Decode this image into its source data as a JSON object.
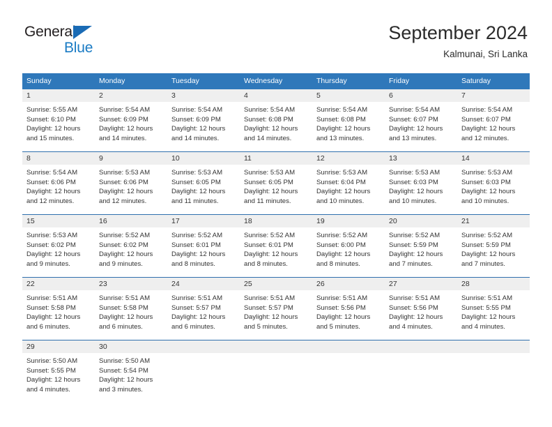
{
  "logo": {
    "line1": "General",
    "line2": "Blue",
    "triangle_icon": "blue-triangle-icon",
    "colors": {
      "general": "#231f20",
      "blue": "#1a7bc4",
      "triangle": "#1a6bb5"
    }
  },
  "header": {
    "title": "September 2024",
    "subtitle": "Kalmunai, Sri Lanka"
  },
  "colors": {
    "header_bar": "#2f78ba",
    "row_divider": "#2f6fad",
    "day_band": "#efefef",
    "text": "#333333"
  },
  "weekdays": [
    "Sunday",
    "Monday",
    "Tuesday",
    "Wednesday",
    "Thursday",
    "Friday",
    "Saturday"
  ],
  "weeks": [
    [
      {
        "day": "1",
        "sunrise": "Sunrise: 5:55 AM",
        "sunset": "Sunset: 6:10 PM",
        "daylight1": "Daylight: 12 hours",
        "daylight2": "and 15 minutes."
      },
      {
        "day": "2",
        "sunrise": "Sunrise: 5:54 AM",
        "sunset": "Sunset: 6:09 PM",
        "daylight1": "Daylight: 12 hours",
        "daylight2": "and 14 minutes."
      },
      {
        "day": "3",
        "sunrise": "Sunrise: 5:54 AM",
        "sunset": "Sunset: 6:09 PM",
        "daylight1": "Daylight: 12 hours",
        "daylight2": "and 14 minutes."
      },
      {
        "day": "4",
        "sunrise": "Sunrise: 5:54 AM",
        "sunset": "Sunset: 6:08 PM",
        "daylight1": "Daylight: 12 hours",
        "daylight2": "and 14 minutes."
      },
      {
        "day": "5",
        "sunrise": "Sunrise: 5:54 AM",
        "sunset": "Sunset: 6:08 PM",
        "daylight1": "Daylight: 12 hours",
        "daylight2": "and 13 minutes."
      },
      {
        "day": "6",
        "sunrise": "Sunrise: 5:54 AM",
        "sunset": "Sunset: 6:07 PM",
        "daylight1": "Daylight: 12 hours",
        "daylight2": "and 13 minutes."
      },
      {
        "day": "7",
        "sunrise": "Sunrise: 5:54 AM",
        "sunset": "Sunset: 6:07 PM",
        "daylight1": "Daylight: 12 hours",
        "daylight2": "and 12 minutes."
      }
    ],
    [
      {
        "day": "8",
        "sunrise": "Sunrise: 5:54 AM",
        "sunset": "Sunset: 6:06 PM",
        "daylight1": "Daylight: 12 hours",
        "daylight2": "and 12 minutes."
      },
      {
        "day": "9",
        "sunrise": "Sunrise: 5:53 AM",
        "sunset": "Sunset: 6:06 PM",
        "daylight1": "Daylight: 12 hours",
        "daylight2": "and 12 minutes."
      },
      {
        "day": "10",
        "sunrise": "Sunrise: 5:53 AM",
        "sunset": "Sunset: 6:05 PM",
        "daylight1": "Daylight: 12 hours",
        "daylight2": "and 11 minutes."
      },
      {
        "day": "11",
        "sunrise": "Sunrise: 5:53 AM",
        "sunset": "Sunset: 6:05 PM",
        "daylight1": "Daylight: 12 hours",
        "daylight2": "and 11 minutes."
      },
      {
        "day": "12",
        "sunrise": "Sunrise: 5:53 AM",
        "sunset": "Sunset: 6:04 PM",
        "daylight1": "Daylight: 12 hours",
        "daylight2": "and 10 minutes."
      },
      {
        "day": "13",
        "sunrise": "Sunrise: 5:53 AM",
        "sunset": "Sunset: 6:03 PM",
        "daylight1": "Daylight: 12 hours",
        "daylight2": "and 10 minutes."
      },
      {
        "day": "14",
        "sunrise": "Sunrise: 5:53 AM",
        "sunset": "Sunset: 6:03 PM",
        "daylight1": "Daylight: 12 hours",
        "daylight2": "and 10 minutes."
      }
    ],
    [
      {
        "day": "15",
        "sunrise": "Sunrise: 5:53 AM",
        "sunset": "Sunset: 6:02 PM",
        "daylight1": "Daylight: 12 hours",
        "daylight2": "and 9 minutes."
      },
      {
        "day": "16",
        "sunrise": "Sunrise: 5:52 AM",
        "sunset": "Sunset: 6:02 PM",
        "daylight1": "Daylight: 12 hours",
        "daylight2": "and 9 minutes."
      },
      {
        "day": "17",
        "sunrise": "Sunrise: 5:52 AM",
        "sunset": "Sunset: 6:01 PM",
        "daylight1": "Daylight: 12 hours",
        "daylight2": "and 8 minutes."
      },
      {
        "day": "18",
        "sunrise": "Sunrise: 5:52 AM",
        "sunset": "Sunset: 6:01 PM",
        "daylight1": "Daylight: 12 hours",
        "daylight2": "and 8 minutes."
      },
      {
        "day": "19",
        "sunrise": "Sunrise: 5:52 AM",
        "sunset": "Sunset: 6:00 PM",
        "daylight1": "Daylight: 12 hours",
        "daylight2": "and 8 minutes."
      },
      {
        "day": "20",
        "sunrise": "Sunrise: 5:52 AM",
        "sunset": "Sunset: 5:59 PM",
        "daylight1": "Daylight: 12 hours",
        "daylight2": "and 7 minutes."
      },
      {
        "day": "21",
        "sunrise": "Sunrise: 5:52 AM",
        "sunset": "Sunset: 5:59 PM",
        "daylight1": "Daylight: 12 hours",
        "daylight2": "and 7 minutes."
      }
    ],
    [
      {
        "day": "22",
        "sunrise": "Sunrise: 5:51 AM",
        "sunset": "Sunset: 5:58 PM",
        "daylight1": "Daylight: 12 hours",
        "daylight2": "and 6 minutes."
      },
      {
        "day": "23",
        "sunrise": "Sunrise: 5:51 AM",
        "sunset": "Sunset: 5:58 PM",
        "daylight1": "Daylight: 12 hours",
        "daylight2": "and 6 minutes."
      },
      {
        "day": "24",
        "sunrise": "Sunrise: 5:51 AM",
        "sunset": "Sunset: 5:57 PM",
        "daylight1": "Daylight: 12 hours",
        "daylight2": "and 6 minutes."
      },
      {
        "day": "25",
        "sunrise": "Sunrise: 5:51 AM",
        "sunset": "Sunset: 5:57 PM",
        "daylight1": "Daylight: 12 hours",
        "daylight2": "and 5 minutes."
      },
      {
        "day": "26",
        "sunrise": "Sunrise: 5:51 AM",
        "sunset": "Sunset: 5:56 PM",
        "daylight1": "Daylight: 12 hours",
        "daylight2": "and 5 minutes."
      },
      {
        "day": "27",
        "sunrise": "Sunrise: 5:51 AM",
        "sunset": "Sunset: 5:56 PM",
        "daylight1": "Daylight: 12 hours",
        "daylight2": "and 4 minutes."
      },
      {
        "day": "28",
        "sunrise": "Sunrise: 5:51 AM",
        "sunset": "Sunset: 5:55 PM",
        "daylight1": "Daylight: 12 hours",
        "daylight2": "and 4 minutes."
      }
    ],
    [
      {
        "day": "29",
        "sunrise": "Sunrise: 5:50 AM",
        "sunset": "Sunset: 5:55 PM",
        "daylight1": "Daylight: 12 hours",
        "daylight2": "and 4 minutes."
      },
      {
        "day": "30",
        "sunrise": "Sunrise: 5:50 AM",
        "sunset": "Sunset: 5:54 PM",
        "daylight1": "Daylight: 12 hours",
        "daylight2": "and 3 minutes."
      },
      {
        "day": "",
        "sunrise": "",
        "sunset": "",
        "daylight1": "",
        "daylight2": ""
      },
      {
        "day": "",
        "sunrise": "",
        "sunset": "",
        "daylight1": "",
        "daylight2": ""
      },
      {
        "day": "",
        "sunrise": "",
        "sunset": "",
        "daylight1": "",
        "daylight2": ""
      },
      {
        "day": "",
        "sunrise": "",
        "sunset": "",
        "daylight1": "",
        "daylight2": ""
      },
      {
        "day": "",
        "sunrise": "",
        "sunset": "",
        "daylight1": "",
        "daylight2": ""
      }
    ]
  ]
}
